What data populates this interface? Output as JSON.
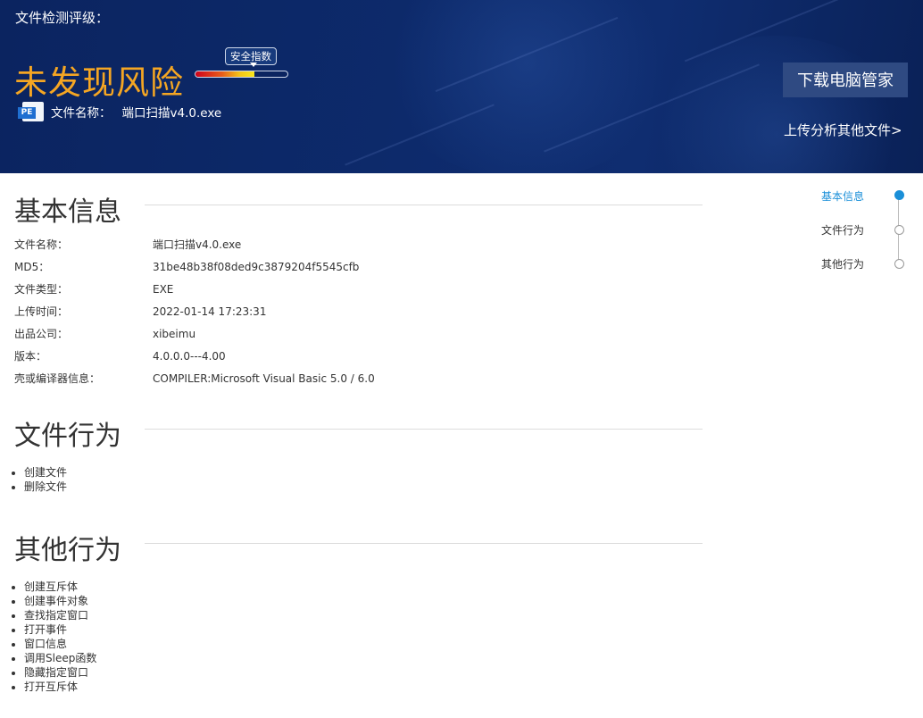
{
  "header": {
    "rating_label": "文件检测评级：",
    "verdict": "未发现风险",
    "safety_index_label": "安全指数",
    "safety_index_level": 0.64,
    "file_icon_text": "PE",
    "file_name_label": "文件名称：",
    "file_name": "端口扫描v4.0.exe",
    "download_button": "下载电脑管家",
    "upload_link": "上传分析其他文件>"
  },
  "basic_info": {
    "title": "基本信息",
    "rows": [
      {
        "label": "文件名称：",
        "value": "端口扫描v4.0.exe"
      },
      {
        "label": "MD5：",
        "value": "31be48b38f08ded9c3879204f5545cfb"
      },
      {
        "label": "文件类型：",
        "value": "EXE"
      },
      {
        "label": "上传时间：",
        "value": "2022-01-14 17:23:31"
      },
      {
        "label": "出品公司：",
        "value": "xibeimu"
      },
      {
        "label": "版本：",
        "value": "4.0.0.0---4.00"
      },
      {
        "label": "壳或编译器信息：",
        "value": "COMPILER:Microsoft Visual Basic 5.0 / 6.0"
      }
    ]
  },
  "file_behavior": {
    "title": "文件行为",
    "items": [
      "创建文件",
      "删除文件"
    ]
  },
  "other_behavior": {
    "title": "其他行为",
    "items": [
      "创建互斥体",
      "创建事件对象",
      "查找指定窗口",
      "打开事件",
      "窗口信息",
      "调用Sleep函数",
      "隐藏指定窗口",
      "打开互斥体"
    ]
  },
  "side_nav": {
    "items": [
      {
        "label": "基本信息",
        "active": true
      },
      {
        "label": "文件行为",
        "active": false
      },
      {
        "label": "其他行为",
        "active": false
      }
    ]
  },
  "colors": {
    "banner": "#0d2a6b",
    "verdict": "#f5a623",
    "accent": "#1a8fd8",
    "button": "#2f4a82"
  }
}
